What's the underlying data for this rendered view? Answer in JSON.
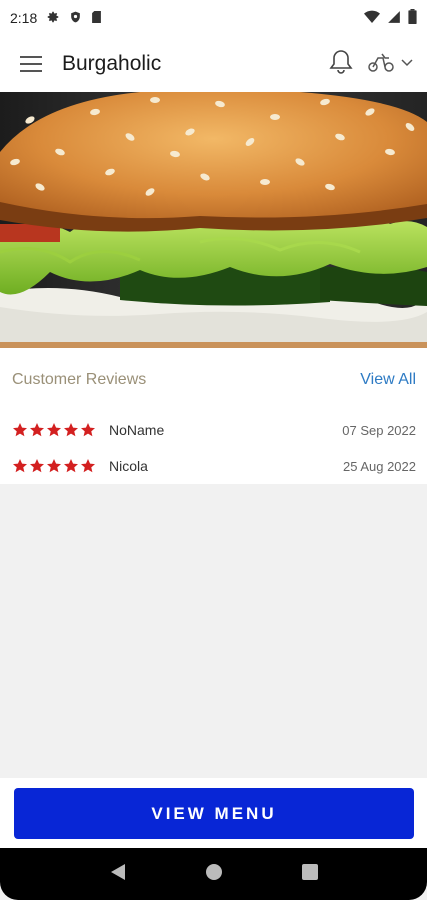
{
  "status_bar": {
    "time": "2:18",
    "left_icons": [
      "gear-icon",
      "shield-icon",
      "sd-card-icon"
    ],
    "right_icons": [
      "wifi-icon",
      "signal-icon",
      "battery-icon"
    ]
  },
  "app_bar": {
    "title": "Burgaholic",
    "menu_icon": "hamburger-menu-icon",
    "notification_icon": "bell-icon",
    "delivery_icon": "scooter-icon"
  },
  "hero": {
    "image": "burger-photo"
  },
  "reviews": {
    "title": "Customer Reviews",
    "view_all": "View All",
    "items": [
      {
        "name": "NoName",
        "rating": 5,
        "date": "07 Sep 2022"
      },
      {
        "name": "Nicola",
        "rating": 5,
        "date": "25 Aug 2022"
      }
    ]
  },
  "cta": {
    "label": "VIEW MENU"
  },
  "colors": {
    "primary": "#0826d6",
    "star": "#d32020",
    "link": "#2e7bc4",
    "muted_title": "#9a9078"
  }
}
